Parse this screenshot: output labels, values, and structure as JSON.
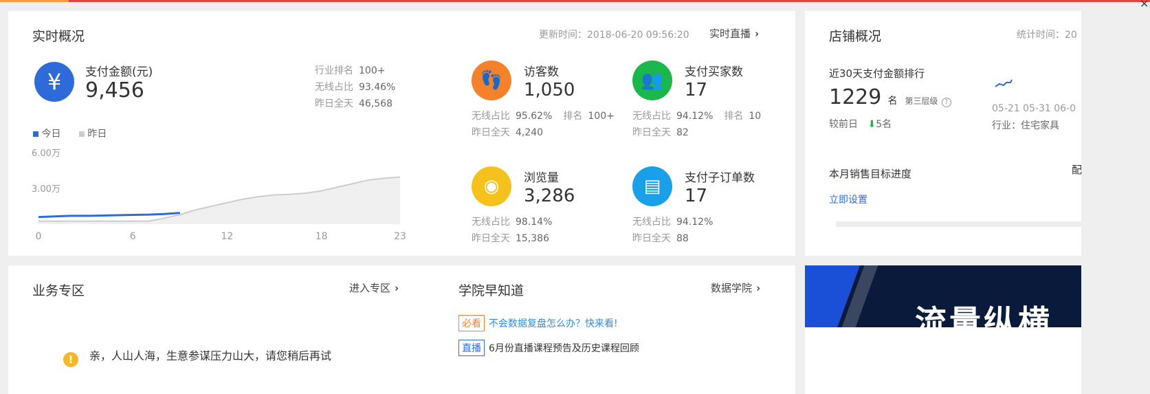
{
  "realtime": {
    "title": "实时概况",
    "update_time": "更新时间：2018-06-20 09:56:20",
    "live_link": "实时直播",
    "payment": {
      "label": "支付金额(元)",
      "value": "9,456",
      "industry_rank_label": "行业排名",
      "industry_rank_value": "100+",
      "wireless_label": "无线占比",
      "wireless_value": "93.46%",
      "yesterday_label": "昨日全天",
      "yesterday_value": "46,568",
      "icon": "yen-icon",
      "icon_color": "#2f6bd8"
    },
    "legend_today": "今日",
    "legend_yesterday": "昨日",
    "y_tick_top": "6.00万",
    "y_tick_mid": "3.00万",
    "x_ticks": [
      "0",
      "6",
      "12",
      "18",
      "23"
    ],
    "metrics": {
      "visitors": {
        "label": "访客数",
        "value": "1,050",
        "wireless": "无线占比",
        "wireless_value": "95.62%",
        "rank_label": "排名",
        "rank_value": "100+",
        "yesterday": "昨日全天",
        "yesterday_value": "4,240",
        "color": "#f5822a",
        "icon": "footprint-icon"
      },
      "buyers": {
        "label": "支付买家数",
        "value": "17",
        "wireless": "无线占比",
        "wireless_value": "94.12%",
        "rank_label": "排名",
        "rank_value": "10",
        "yesterday": "昨日全天",
        "yesterday_value": "82",
        "color": "#1ab84a",
        "icon": "users-icon"
      },
      "pageviews": {
        "label": "浏览量",
        "value": "3,286",
        "wireless": "无线占比",
        "wireless_value": "98.14%",
        "yesterday": "昨日全天",
        "yesterday_value": "15,386",
        "color": "#f5c21d",
        "icon": "eye-icon"
      },
      "suborders": {
        "label": "支付子订单数",
        "value": "17",
        "wireless": "无线占比",
        "wireless_value": "94.12%",
        "yesterday": "昨日全天",
        "yesterday_value": "88",
        "color": "#1aa0e8",
        "icon": "document-icon"
      }
    }
  },
  "chart_data": {
    "type": "line",
    "x": [
      0,
      1,
      2,
      3,
      4,
      5,
      6,
      7,
      8,
      9,
      10,
      11,
      12,
      13,
      14,
      15,
      16,
      17,
      18,
      19,
      20,
      21,
      22,
      23
    ],
    "xlim": [
      0,
      23
    ],
    "ylim": [
      0,
      60000
    ],
    "series": [
      {
        "name": "今日",
        "color": "#2f6bd8",
        "values": [
          6000,
          6500,
          7000,
          7000,
          7200,
          7500,
          7800,
          8000,
          8500,
          9456
        ]
      },
      {
        "name": "昨日",
        "color": "#cccccc",
        "values": [
          2500,
          2500,
          2500,
          2500,
          2500,
          2500,
          2500,
          2500,
          5000,
          8000,
          12000,
          15000,
          18000,
          21000,
          23000,
          24500,
          25000,
          26000,
          28000,
          31000,
          34000,
          37000,
          38500,
          39500
        ]
      }
    ],
    "grid": false,
    "legend": "top-left"
  },
  "store": {
    "title": "店铺概况",
    "stat_time": "统计时间：20",
    "rank_title": "近30天支付金额排行",
    "rank_value": "1229",
    "rank_unit": "名",
    "rank_tier": "第三层级",
    "vs_yesterday": "较前日",
    "vs_change": "5名",
    "dates": "05-21 05-31 06-0",
    "industry": "行业：住宅家具",
    "target_title": "本月销售目标进度",
    "target_right": "配",
    "set_link": "立即设置"
  },
  "business": {
    "title": "业务专区",
    "enter_link": "进入专区",
    "message": "亲，人山人海，生意参谋压力山大，请您稍后再试"
  },
  "academy": {
    "title": "学院早知道",
    "link": "数据学院",
    "items": [
      {
        "tag": "必看",
        "text": "不会数据复盘怎么办？快来看!",
        "color": "#f5822a",
        "text_color": "#2f8fd8"
      },
      {
        "tag": "直播",
        "text": "6月份直播课程预告及历史课程回顾",
        "color": "#2f6bd8",
        "text_color": "#333333"
      }
    ]
  },
  "banner": {
    "text": "流量纵横"
  }
}
